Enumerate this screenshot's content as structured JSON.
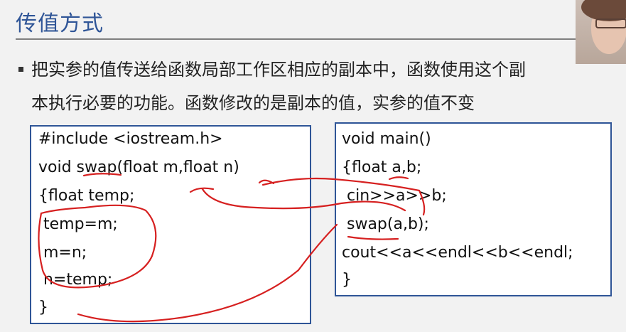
{
  "slide": {
    "title": "传值方式",
    "bullet_line1": "把实参的值传送给函数局部工作区相应的副本中，函数使用这个副",
    "bullet_line2": "本执行必要的功能。函数修改的是副本的值，实参的值不变"
  },
  "code_left": [
    "#include <iostream.h>",
    "void swap(float m,float n)",
    "{float temp;",
    " temp=m;",
    " m=n;",
    " n=temp;",
    "}"
  ],
  "code_right": [
    "void main()",
    "{float a,b;",
    " cin>>a>>b;",
    " swap(a,b);",
    "cout<<a<<endl<<b<<endl;",
    "}"
  ],
  "colors": {
    "title": "#2f5597",
    "box_border": "#2f5597",
    "annotation": "#d62020"
  },
  "video_overlay": {
    "icon": "presenter-webcam"
  }
}
